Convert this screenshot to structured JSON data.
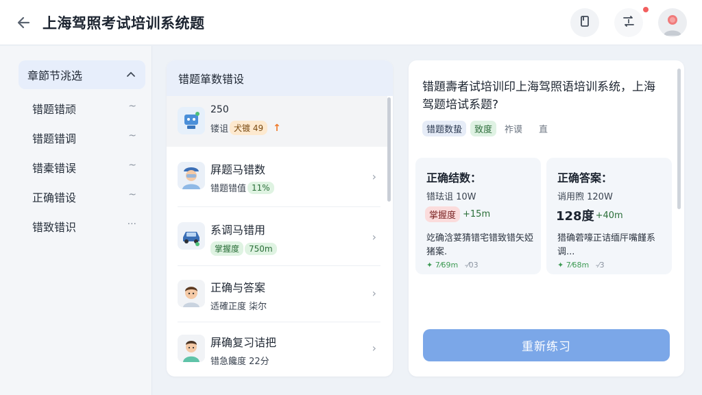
{
  "header": {
    "title": "上海驾照考试培训系统题",
    "icons": [
      "back-arrow-icon",
      "bookmark-icon",
      "flip-icon",
      "user-avatar"
    ]
  },
  "sidebar": {
    "head_label": "章節节洮选",
    "items": [
      {
        "label": "错题错顽",
        "tail": "~"
      },
      {
        "label": "错题错调",
        "tail": "~"
      },
      {
        "label": "错橐错误",
        "tail": "~"
      },
      {
        "label": "正确错设",
        "tail": "~"
      },
      {
        "label": "错致错识",
        "tail": "···"
      }
    ]
  },
  "list": {
    "header": "错题箪数错设",
    "rows": [
      {
        "title": "250",
        "sub_text": "镂诅",
        "pill": "犬镀 49",
        "pill_color": "orange",
        "trend": "↑"
      },
      {
        "title": "屛题马错数",
        "sub_text": "错题错值",
        "pill": "11%",
        "pill_color": "green"
      },
      {
        "title": "系调马错用",
        "sub_text": "",
        "pill": "掌握度",
        "pill2": "750m",
        "pill_color": "green"
      },
      {
        "title": "正确与答案",
        "sub_text": "适確正度 柒尔",
        "pill": "",
        "pill_color": ""
      },
      {
        "title": "屛确复习诘把",
        "sub_text": "错急饞度 22分",
        "pill": "",
        "pill_color": ""
      }
    ]
  },
  "detail": {
    "question": "错題壽者试培训印上海驾照语培训系统，上海驾题培试系题?",
    "tags": [
      {
        "label": "错题数蛰",
        "style": "blue"
      },
      {
        "label": "致度",
        "style": "green"
      },
      {
        "label": "祚谟",
        "style": "plain"
      },
      {
        "label": "直",
        "style": "plain"
      }
    ],
    "cards": [
      {
        "title": "正确结数：",
        "line1": "错珐诅  10W",
        "badge": "掌握度",
        "badge_style": "red",
        "delta": "+15m",
        "desc": "䇄确浛荽猜错宅错致错矢婭猪案.",
        "foot_a": "✦ 7⁄69m",
        "foot_b": "-⁄03"
      },
      {
        "title": "正确答案：",
        "line1": "诮用煦  120W",
        "badge": "128度",
        "badge_style": "big",
        "delta": "+40m",
        "desc": "猎确菪嚎正诘缅厈嘴饉系调...",
        "foot_a": "✦ 7⁄68m",
        "foot_b": "-⁄3"
      }
    ],
    "retry_label": "重新练习"
  }
}
